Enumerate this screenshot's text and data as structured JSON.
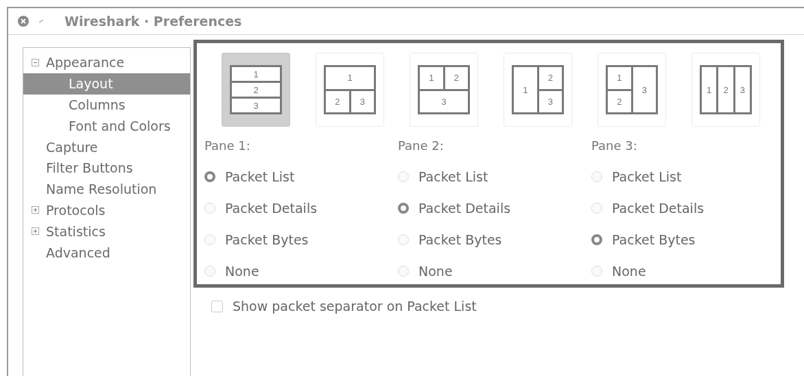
{
  "window": {
    "title": "Wireshark · Preferences"
  },
  "sidebar": {
    "items": [
      {
        "label": "Appearance",
        "expanded": true,
        "selected": false,
        "children": [
          {
            "label": "Layout",
            "selected": true
          },
          {
            "label": "Columns",
            "selected": false
          },
          {
            "label": "Font and Colors",
            "selected": false
          }
        ]
      },
      {
        "label": "Capture",
        "selected": false
      },
      {
        "label": "Filter Buttons",
        "selected": false
      },
      {
        "label": "Name Resolution",
        "selected": false
      },
      {
        "label": "Protocols",
        "expanded": false,
        "selected": false
      },
      {
        "label": "Statistics",
        "expanded": false,
        "selected": false
      },
      {
        "label": "Advanced",
        "selected": false
      }
    ]
  },
  "layouts": [
    {
      "kind": "rows3",
      "selected": true,
      "cells": [
        "1",
        "2",
        "3"
      ]
    },
    {
      "kind": "top1-bottom2",
      "selected": false,
      "cells": [
        "1",
        "2",
        "3"
      ]
    },
    {
      "kind": "top2-bottom1",
      "selected": false,
      "cells": [
        "1",
        "2",
        "3"
      ]
    },
    {
      "kind": "left1-right2",
      "selected": false,
      "cells": [
        "1",
        "2",
        "3"
      ]
    },
    {
      "kind": "left2-right1",
      "selected": false,
      "cells": [
        "1",
        "2",
        "3"
      ]
    },
    {
      "kind": "cols3",
      "selected": false,
      "cells": [
        "1",
        "2",
        "3"
      ]
    }
  ],
  "panes": [
    {
      "label": "Pane 1:",
      "options": [
        {
          "label": "Packet List",
          "selected": true
        },
        {
          "label": "Packet Details",
          "selected": false
        },
        {
          "label": "Packet Bytes",
          "selected": false
        },
        {
          "label": "None",
          "selected": false
        }
      ]
    },
    {
      "label": "Pane 2:",
      "options": [
        {
          "label": "Packet List",
          "selected": false
        },
        {
          "label": "Packet Details",
          "selected": true
        },
        {
          "label": "Packet Bytes",
          "selected": false
        },
        {
          "label": "None",
          "selected": false
        }
      ]
    },
    {
      "label": "Pane 3:",
      "options": [
        {
          "label": "Packet List",
          "selected": false
        },
        {
          "label": "Packet Details",
          "selected": false
        },
        {
          "label": "Packet Bytes",
          "selected": true
        },
        {
          "label": "None",
          "selected": false
        }
      ]
    }
  ],
  "separator_option": {
    "label": "Show packet separator on Packet List",
    "checked": false
  }
}
